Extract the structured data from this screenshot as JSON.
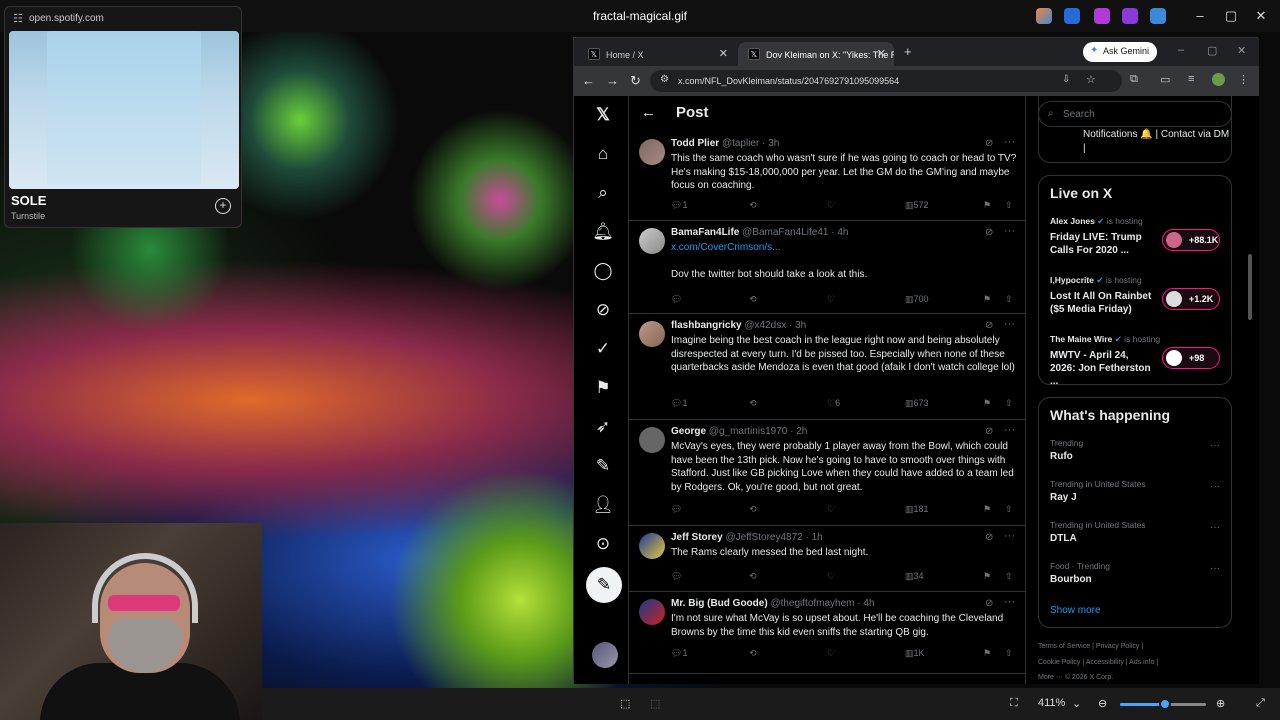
{
  "window": {
    "title": "fractal-magical.gif"
  },
  "spotify": {
    "url": "open.spotify.com",
    "song": "SOLE",
    "artist": "Turnstile"
  },
  "viewer": {
    "zoom": "411%",
    "zoom_fraction": 0.52
  },
  "browser": {
    "tabs": [
      {
        "label": "Home / X"
      },
      {
        "label": "Dov Kleiman on X: \"Yikes: The R"
      }
    ],
    "ask_label": "Ask Gemini",
    "url": "x.com/NFL_DovKleiman/status/2047692791095099564"
  },
  "x": {
    "page_title": "Post",
    "tweets": [
      {
        "name": "Todd Plier",
        "handle": "@taplier · 3h",
        "text": "This the same coach who wasn't sure if he was going to coach or head to TV? He's making $15-18,000,000 per year. Let the GM do the GM'ing and maybe focus on coaching.",
        "replies": "1",
        "likes": "",
        "views": "572"
      },
      {
        "name": "BamaFan4Life",
        "handle": "@BamaFan4Life41 · 4h",
        "link": "x.com/CoverCrimson/s...",
        "text": "Dov the twitter bot should take a look at this.",
        "replies": "",
        "likes": "",
        "views": "700"
      },
      {
        "name": "flashbangricky",
        "handle": "@x42dsx · 3h",
        "text": "Imagine being the best coach in the league right now and being absolutely disrespected at every turn. I'd be pissed too. Especially when none of these quarterbacks aside Mendoza is even that good (afaik I don't watch college lol)",
        "replies": "1",
        "likes": "6",
        "views": "673"
      },
      {
        "name": "George",
        "handle": "@g_martinis1970 · 2h",
        "text": "McVay's eyes, they were probably 1 player away from the Bowl, which could have been the 13th pick.  Now he's going to have to smooth over things with Stafford.  Just like GB picking Love when they could have added to a team led by Rodgers.  Ok, you're good, but not great.",
        "replies": "",
        "likes": "",
        "views": "181"
      },
      {
        "name": "Jeff Storey",
        "handle": "@JeffStorey4872 · 1h",
        "text": "The Rams clearly messed the bed last night.",
        "replies": "",
        "likes": "",
        "views": "34"
      },
      {
        "name": "Mr. Big (Bud Goode)",
        "handle": "@thegiftofmayhem · 4h",
        "text": "I'm not sure what McVay is so upset about. He'll be coaching the Cleveland Browns by the time this kid even sniffs the starting QB gig.",
        "replies": "1",
        "likes": "",
        "views": "1K"
      }
    ],
    "search_placeholder": "Search",
    "notif_text": "Notifications 🔔 | Contact via DM |",
    "live": {
      "title": "Live on X",
      "hosting": "is hosting",
      "items": [
        {
          "host": "Alex Jones",
          "title": "Friday LIVE: Trump Calls For 2020 ...",
          "count": "+88.1K"
        },
        {
          "host": "I,Hypocrite",
          "title": "Lost It All On Rainbet ($5 Media Friday)",
          "count": "+1.2K"
        },
        {
          "host": "The Maine Wire",
          "title": "MWTV - April 24, 2026: Jon Fetherston ...",
          "count": "+98"
        }
      ]
    },
    "happening": {
      "title": "What's happening",
      "items": [
        {
          "context": "Trending",
          "name": "Rufo"
        },
        {
          "context": "Trending in United States",
          "name": "Ray J"
        },
        {
          "context": "Trending in United States",
          "name": "DTLA"
        },
        {
          "context": "Food · Trending",
          "name": "Bourbon"
        }
      ],
      "show_more": "Show more"
    },
    "footer": {
      "line1": "Terms of Service  |   Privacy Policy  |",
      "line2": "Cookie Policy  |   Accessibility  |   Ads info  |",
      "line3": "More ···    © 2026 X Corp."
    }
  }
}
